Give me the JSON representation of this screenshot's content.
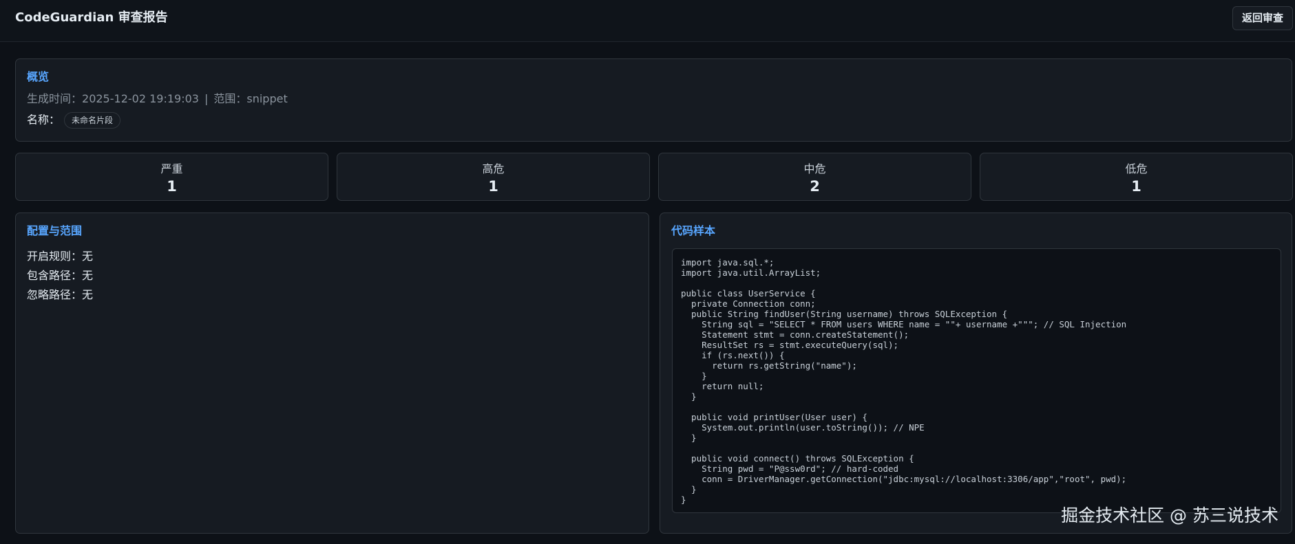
{
  "app": {
    "title": "CodeGuardian 审查报告",
    "back_button": "返回审查"
  },
  "overview": {
    "title": "概览",
    "generated_label": "生成时间：",
    "generated_value": "2025-12-02 19:19:03",
    "separator": "|",
    "scope_label": "范围：",
    "scope_value": "snippet",
    "name_label": "名称：",
    "name_value": "未命名片段"
  },
  "stats": [
    {
      "label": "严重",
      "value": "1"
    },
    {
      "label": "高危",
      "value": "1"
    },
    {
      "label": "中危",
      "value": "2"
    },
    {
      "label": "低危",
      "value": "1"
    }
  ],
  "config": {
    "title": "配置与范围",
    "rows": [
      "开启规则：无",
      "包含路径：无",
      "忽略路径：无"
    ]
  },
  "code_sample": {
    "title": "代码样本",
    "code": "import java.sql.*;\nimport java.util.ArrayList;\n\npublic class UserService {\n  private Connection conn;\n  public String findUser(String username) throws SQLException {\n    String sql = \"SELECT * FROM users WHERE name = \"\"+ username +\"\"\"; // SQL Injection\n    Statement stmt = conn.createStatement();\n    ResultSet rs = stmt.executeQuery(sql);\n    if (rs.next()) {\n      return rs.getString(\"name\");\n    }\n    return null;\n  }\n\n  public void printUser(User user) {\n    System.out.println(user.toString()); // NPE\n  }\n\n  public void connect() throws SQLException {\n    String pwd = \"P@ssw0rd\"; // hard-coded\n    conn = DriverManager.getConnection(\"jdbc:mysql://localhost:3306/app\",\"root\", pwd);\n  }\n}"
  },
  "watermark": "掘金技术社区 @ 苏三说技术"
}
